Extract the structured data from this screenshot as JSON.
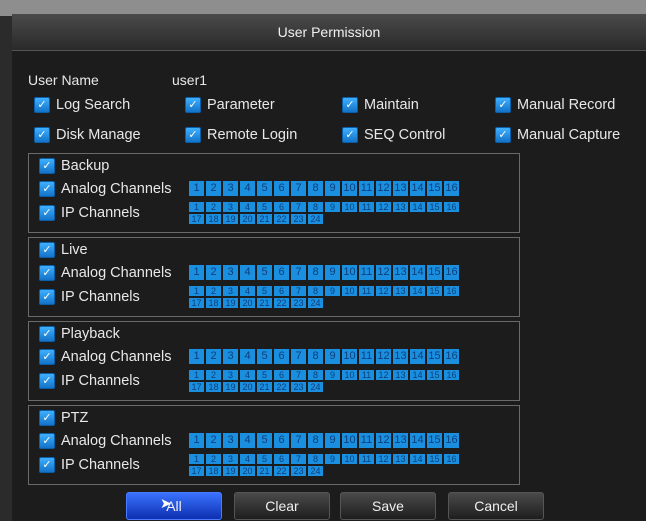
{
  "title": "User Permission",
  "user": {
    "label": "User Name",
    "value": "user1"
  },
  "permissions": [
    {
      "label": "Log Search",
      "checked": true
    },
    {
      "label": "Parameter",
      "checked": true
    },
    {
      "label": "Maintain",
      "checked": true
    },
    {
      "label": "Manual Record",
      "checked": true
    },
    {
      "label": "Disk Manage",
      "checked": true
    },
    {
      "label": "Remote Login",
      "checked": true
    },
    {
      "label": "SEQ Control",
      "checked": true
    },
    {
      "label": "Manual Capture",
      "checked": true
    }
  ],
  "groups": [
    {
      "label": "Backup",
      "analog": "Analog Channels",
      "ip": "IP Channels"
    },
    {
      "label": "Live",
      "analog": "Analog Channels",
      "ip": "IP Channels"
    },
    {
      "label": "Playback",
      "analog": "Analog Channels",
      "ip": "IP Channels"
    },
    {
      "label": "PTZ",
      "analog": "Analog Channels",
      "ip": "IP Channels"
    }
  ],
  "analog_channels": [
    "1",
    "2",
    "3",
    "4",
    "5",
    "6",
    "7",
    "8",
    "9",
    "10",
    "11",
    "12",
    "13",
    "14",
    "15",
    "16"
  ],
  "ip_channels_row1": [
    "1",
    "2",
    "3",
    "4",
    "5",
    "6",
    "7",
    "8",
    "9",
    "10",
    "11",
    "12",
    "13",
    "14",
    "15",
    "16"
  ],
  "ip_channels_row2": [
    "17",
    "18",
    "19",
    "20",
    "21",
    "22",
    "23",
    "24"
  ],
  "buttons": {
    "all": "All",
    "clear": "Clear",
    "save": "Save",
    "cancel": "Cancel"
  }
}
